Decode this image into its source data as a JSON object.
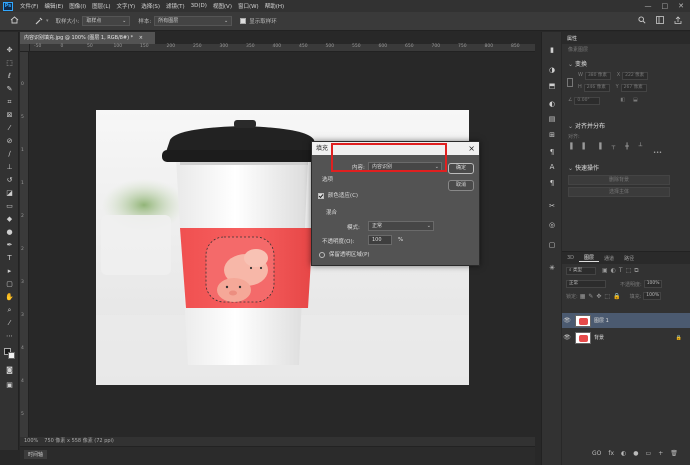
{
  "menubar": {
    "logo": "Ps",
    "items": [
      "文件(F)",
      "编辑(E)",
      "图像(I)",
      "图层(L)",
      "文字(Y)",
      "选择(S)",
      "滤镜(T)",
      "3D(D)",
      "视图(V)",
      "窗口(W)",
      "帮助(H)"
    ],
    "win_min": "—",
    "win_max": "□",
    "win_close": "✕"
  },
  "options": {
    "sample_size_label": "取样大小:",
    "sample_size_value": "取样点",
    "sample_label": "样本:",
    "sample_value": "所有图层",
    "show_ring_label": "显示取样环"
  },
  "document": {
    "tab_title": "内容识别填充.jpg @ 100% (图层 1, RGB/8#) *",
    "tab_close": "×",
    "zoom": "100%",
    "doc_info": "750 像素 x 558 像素 (72 ppi)"
  },
  "rulers": {
    "top": [
      "-50",
      "0",
      "50",
      "100",
      "150",
      "200",
      "250",
      "300",
      "350",
      "400",
      "450",
      "500",
      "550",
      "600",
      "650",
      "700",
      "750",
      "800",
      "850"
    ],
    "left": [
      "0",
      "5",
      "1",
      "1",
      "2",
      "2",
      "3",
      "3",
      "4",
      "4",
      "5"
    ]
  },
  "timeline": {
    "label": "时间轴"
  },
  "dialog": {
    "title": "填充",
    "content_label": "内容:",
    "content_value": "内容识别",
    "ok_label": "确定",
    "cancel_label": "取消",
    "options_label": "选项",
    "color_adapt_label": "颜色适应(C)",
    "blend_label": "混合",
    "mode_label": "模式:",
    "mode_value": "正常",
    "opacity_label": "不透明度(O):",
    "opacity_value": "100",
    "opacity_unit": "%",
    "preserve_label": "保留透明区域(P)"
  },
  "properties": {
    "tab": "属性",
    "pixel_layer": "像素图层",
    "transform_header": "变换",
    "w_label": "W",
    "w_value": "380 像素",
    "h_label": "H",
    "h_value": "246 像素",
    "x_label": "X",
    "x_value": "222 像素",
    "y_label": "Y",
    "y_value": "267 像素",
    "angle_value": "0.00°",
    "align_header": "对齐并分布",
    "align_label": "对齐:",
    "more": "•••",
    "quick_header": "快速操作",
    "remove_bg": "删除背景",
    "select_subject": "选择主体"
  },
  "layers": {
    "tabs": [
      "3D",
      "图层",
      "通道",
      "路径"
    ],
    "active_tab": "图层",
    "filter_label": "类型",
    "blend_mode": "正常",
    "opacity_label": "不透明度:",
    "opacity_value": "100%",
    "lock_label": "锁定:",
    "fill_label": "填充:",
    "fill_value": "100%",
    "items": [
      {
        "name": "图层 1",
        "selected": true
      },
      {
        "name": "背景",
        "selected": false
      }
    ],
    "bottom_icons": [
      "GO",
      "fx",
      "◐",
      "●",
      "▭",
      "+",
      "🗑"
    ]
  },
  "colors": {
    "accent": "#31a8ff",
    "highlight_box": "#e02020",
    "sleeve_red": "#f04848",
    "lid": "#1e1e1e"
  }
}
